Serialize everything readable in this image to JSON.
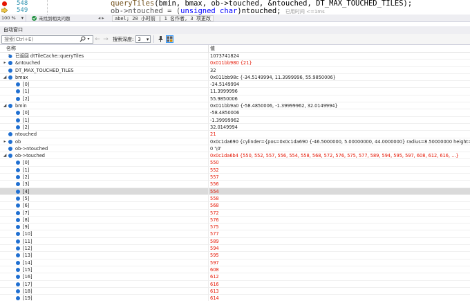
{
  "editor": {
    "lines": [
      {
        "number": "548",
        "code_fn": "queryTiles",
        "code_rest": "(bmin, bmax, ob->touched, &ntouched, DT_MAX_TOUCHED_TILES);"
      },
      {
        "number": "549",
        "code_pre": "ob->ntouched = (",
        "code_kw": "unsigned char",
        "code_post": ")ntouched;",
        "hint": "已用时间 <=1ms"
      }
    ]
  },
  "status": {
    "zoom": "100 %",
    "issue_text": "未找到相关问题",
    "codelens": "abel; 20 小时前 | 1 名作者, 3 项更改"
  },
  "autos": {
    "title": "自动窗口",
    "search_placeholder": "搜索(Ctrl+E)",
    "depth_label": "搜索深度:",
    "depth_value": "3",
    "col_name": "名称",
    "col_value": "值",
    "rows": [
      {
        "level": 0,
        "exp": "",
        "icon": "return-icon",
        "name": "已返回 dtTileCache::queryTiles",
        "value": "1073741824",
        "changed": false
      },
      {
        "level": 0,
        "exp": "▸",
        "icon": "var-icon",
        "name": "&ntouched",
        "value": "0x011bb980 {21}",
        "changed": true
      },
      {
        "level": 0,
        "exp": "",
        "icon": "var-icon",
        "name": "DT_MAX_TOUCHED_TILES",
        "value": "32",
        "changed": false
      },
      {
        "level": 0,
        "exp": "◢",
        "icon": "var-icon",
        "name": "bmax",
        "value": "0x011bb98c {-34.5149994, 11.3999996, 55.9850006}",
        "changed": false
      },
      {
        "level": 1,
        "exp": "",
        "icon": "var-icon",
        "name": "[0]",
        "value": "-34.5149994",
        "changed": false
      },
      {
        "level": 1,
        "exp": "",
        "icon": "var-icon",
        "name": "[1]",
        "value": "11.3999996",
        "changed": false
      },
      {
        "level": 1,
        "exp": "",
        "icon": "var-icon",
        "name": "[2]",
        "value": "55.9850006",
        "changed": false
      },
      {
        "level": 0,
        "exp": "◢",
        "icon": "var-icon",
        "name": "bmin",
        "value": "0x011bb9a0 {-58.4850006, -1.39999962, 32.0149994}",
        "changed": false
      },
      {
        "level": 1,
        "exp": "",
        "icon": "var-icon",
        "name": "[0]",
        "value": "-58.4850006",
        "changed": false
      },
      {
        "level": 1,
        "exp": "",
        "icon": "var-icon",
        "name": "[1]",
        "value": "-1.39999962",
        "changed": false
      },
      {
        "level": 1,
        "exp": "",
        "icon": "var-icon",
        "name": "[2]",
        "value": "32.0149994",
        "changed": false
      },
      {
        "level": 0,
        "exp": "",
        "icon": "var-icon",
        "name": "ntouched",
        "value": "21",
        "changed": true
      },
      {
        "level": 0,
        "exp": "▸",
        "icon": "var-icon",
        "name": "ob",
        "value": "0x0c1da690 {cylinder={pos=0x0c1da690 {-46.5000000, 5.00000000, 44.0000000} radius=8.50000000 height=...} ...}",
        "changed": false
      },
      {
        "level": 0,
        "exp": "",
        "icon": "var-icon",
        "name": "ob->ntouched",
        "value": "0 '\\0'",
        "changed": false
      },
      {
        "level": 0,
        "exp": "◢",
        "icon": "var-icon",
        "name": "ob->touched",
        "value": "0x0c1da6b4 {550, 552, 557, 556, 554, 558, 568, 572, 576, 575, 577, 589, 594, 595, 597, 608, 612, 616, ...}",
        "changed": true
      },
      {
        "level": 1,
        "exp": "",
        "icon": "var-icon",
        "name": "[0]",
        "value": "550",
        "changed": true
      },
      {
        "level": 1,
        "exp": "",
        "icon": "var-icon",
        "name": "[1]",
        "value": "552",
        "changed": true
      },
      {
        "level": 1,
        "exp": "",
        "icon": "var-icon",
        "name": "[2]",
        "value": "557",
        "changed": true
      },
      {
        "level": 1,
        "exp": "",
        "icon": "var-icon",
        "name": "[3]",
        "value": "556",
        "changed": true
      },
      {
        "level": 1,
        "exp": "",
        "icon": "var-icon",
        "name": "[4]",
        "value": "554",
        "changed": true,
        "selected": true
      },
      {
        "level": 1,
        "exp": "",
        "icon": "var-icon",
        "name": "[5]",
        "value": "558",
        "changed": true
      },
      {
        "level": 1,
        "exp": "",
        "icon": "var-icon",
        "name": "[6]",
        "value": "568",
        "changed": true
      },
      {
        "level": 1,
        "exp": "",
        "icon": "var-icon",
        "name": "[7]",
        "value": "572",
        "changed": true
      },
      {
        "level": 1,
        "exp": "",
        "icon": "var-icon",
        "name": "[8]",
        "value": "576",
        "changed": true
      },
      {
        "level": 1,
        "exp": "",
        "icon": "var-icon",
        "name": "[9]",
        "value": "575",
        "changed": true
      },
      {
        "level": 1,
        "exp": "",
        "icon": "var-icon",
        "name": "[10]",
        "value": "577",
        "changed": true
      },
      {
        "level": 1,
        "exp": "",
        "icon": "var-icon",
        "name": "[11]",
        "value": "589",
        "changed": true
      },
      {
        "level": 1,
        "exp": "",
        "icon": "var-icon",
        "name": "[12]",
        "value": "594",
        "changed": true
      },
      {
        "level": 1,
        "exp": "",
        "icon": "var-icon",
        "name": "[13]",
        "value": "595",
        "changed": true
      },
      {
        "level": 1,
        "exp": "",
        "icon": "var-icon",
        "name": "[14]",
        "value": "597",
        "changed": true
      },
      {
        "level": 1,
        "exp": "",
        "icon": "var-icon",
        "name": "[15]",
        "value": "608",
        "changed": true
      },
      {
        "level": 1,
        "exp": "",
        "icon": "var-icon",
        "name": "[16]",
        "value": "612",
        "changed": true
      },
      {
        "level": 1,
        "exp": "",
        "icon": "var-icon",
        "name": "[17]",
        "value": "616",
        "changed": true
      },
      {
        "level": 1,
        "exp": "",
        "icon": "var-icon",
        "name": "[18]",
        "value": "613",
        "changed": true
      },
      {
        "level": 1,
        "exp": "",
        "icon": "var-icon",
        "name": "[19]",
        "value": "614",
        "changed": true
      }
    ]
  },
  "colors": {
    "changed_value": "#e51400",
    "var_icon": "#1f6fd1",
    "breakpoint": "#e51400",
    "line_number": "#2b91af"
  }
}
